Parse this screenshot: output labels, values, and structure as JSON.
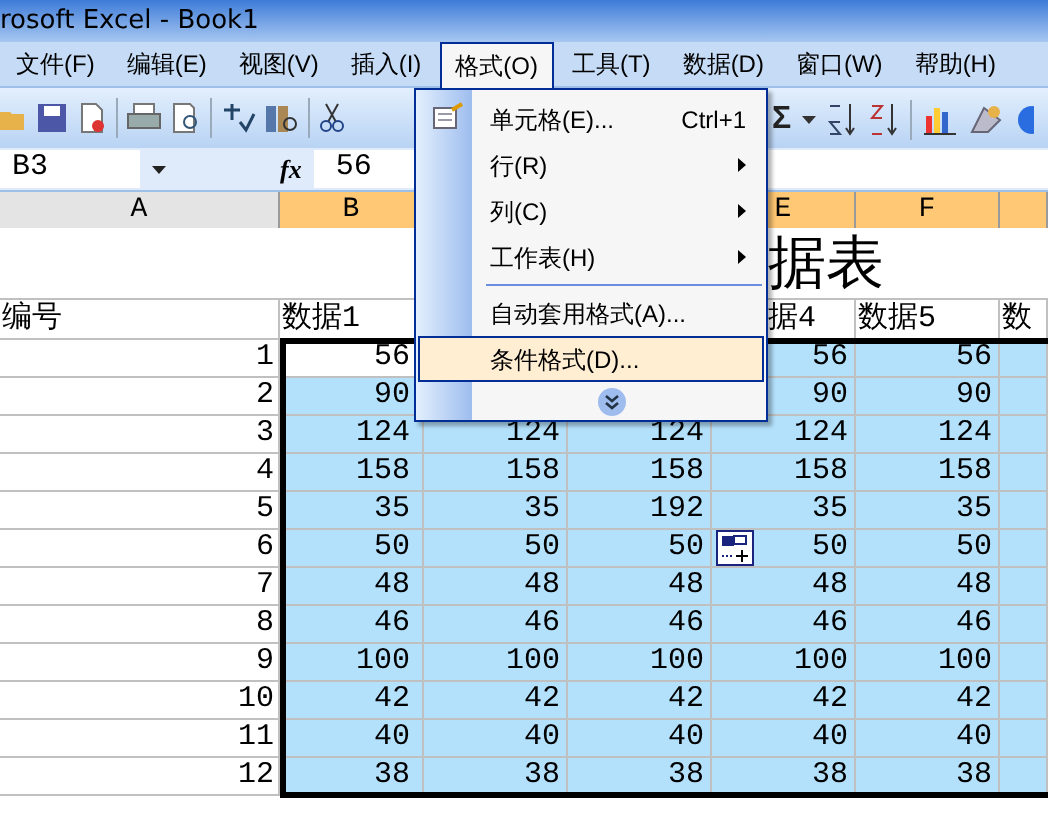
{
  "window": {
    "title": "rosoft Excel - Book1"
  },
  "menu_bar": [
    {
      "label": "文件(F)",
      "selected": false
    },
    {
      "label": "编辑(E)",
      "selected": false
    },
    {
      "label": "视图(V)",
      "selected": false
    },
    {
      "label": "插入(I)",
      "selected": false
    },
    {
      "label": "格式(O)",
      "selected": true
    },
    {
      "label": "工具(T)",
      "selected": false
    },
    {
      "label": "数据(D)",
      "selected": false
    },
    {
      "label": "窗口(W)",
      "selected": false
    },
    {
      "label": "帮助(H)",
      "selected": false
    }
  ],
  "toolbar": {
    "autosum": "Σ"
  },
  "formula_bar": {
    "name_box": "B3",
    "fx": "fx",
    "value": "56"
  },
  "sheet": {
    "columns": {
      "A": {
        "label": "A",
        "selected": false
      },
      "B": {
        "label": "B",
        "selected": true
      },
      "E": {
        "label": "E",
        "selected": true
      },
      "F": {
        "label": "F",
        "selected": true
      },
      "G": {
        "selected": true
      }
    },
    "title_fragment": "据表",
    "header_row": {
      "A": "编号",
      "B": "数据1",
      "E": "据4",
      "F": "数据5",
      "G": "数"
    },
    "rows": [
      {
        "number": "1",
        "cells": {
          "B": {
            "text": "56",
            "active": true
          },
          "E": {
            "text": "56",
            "selected": true,
            "active": false
          },
          "F": {
            "text": "56",
            "selected": true,
            "active": false
          },
          "G": {
            "selected": true,
            "active": false
          }
        }
      },
      {
        "number": "2",
        "cells": {
          "B": {
            "text": "90",
            "selected": true,
            "active": false
          },
          "E": {
            "text": "90",
            "selected": true,
            "active": false
          },
          "F": {
            "text": "90",
            "selected": true,
            "active": false
          },
          "G": {
            "selected": true,
            "active": false
          }
        }
      },
      {
        "number": "3",
        "cells": {
          "B": {
            "text": "124",
            "selected": true,
            "active": false
          },
          "C": {
            "text": "124",
            "selected": true,
            "active": false
          },
          "D": {
            "text": "124",
            "selected": true,
            "active": false
          },
          "E": {
            "text": "124",
            "selected": true,
            "active": false
          },
          "F": {
            "text": "124",
            "selected": true,
            "active": false
          },
          "G": {
            "selected": true,
            "active": false
          }
        }
      },
      {
        "number": "4",
        "cells": {
          "B": {
            "text": "158",
            "selected": true,
            "active": false
          },
          "C": {
            "text": "158",
            "selected": true,
            "active": false
          },
          "D": {
            "text": "158",
            "selected": true,
            "active": false
          },
          "E": {
            "text": "158",
            "selected": true,
            "active": false
          },
          "F": {
            "text": "158",
            "selected": true,
            "active": false
          },
          "G": {
            "selected": true,
            "active": false
          }
        }
      },
      {
        "number": "5",
        "cells": {
          "B": {
            "text": "35",
            "selected": true,
            "active": false
          },
          "C": {
            "text": "35",
            "selected": true,
            "active": false
          },
          "D": {
            "text": "192",
            "selected": true,
            "active": false
          },
          "E": {
            "text": "35",
            "selected": true,
            "active": false
          },
          "F": {
            "text": "35",
            "selected": true,
            "active": false
          },
          "G": {
            "selected": true,
            "active": false
          }
        }
      },
      {
        "number": "6",
        "cells": {
          "B": {
            "text": "50",
            "selected": true,
            "active": false
          },
          "C": {
            "text": "50",
            "selected": true,
            "active": false
          },
          "D": {
            "text": "50",
            "selected": true,
            "active": false
          },
          "E": {
            "text": "50",
            "selected": true,
            "active": false
          },
          "F": {
            "text": "50",
            "selected": true,
            "active": false
          },
          "G": {
            "selected": true,
            "active": false
          }
        }
      },
      {
        "number": "7",
        "cells": {
          "B": {
            "text": "48",
            "selected": true,
            "active": false
          },
          "C": {
            "text": "48",
            "selected": true,
            "active": false
          },
          "D": {
            "text": "48",
            "selected": true,
            "active": false
          },
          "E": {
            "text": "48",
            "selected": true,
            "active": false
          },
          "F": {
            "text": "48",
            "selected": true,
            "active": false
          },
          "G": {
            "selected": true,
            "active": false
          }
        }
      },
      {
        "number": "8",
        "cells": {
          "B": {
            "text": "46",
            "selected": true,
            "active": false
          },
          "C": {
            "text": "46",
            "selected": true,
            "active": false
          },
          "D": {
            "text": "46",
            "selected": true,
            "active": false
          },
          "E": {
            "text": "46",
            "selected": true,
            "active": false
          },
          "F": {
            "text": "46",
            "selected": true,
            "active": false
          },
          "G": {
            "selected": true,
            "active": false
          }
        }
      },
      {
        "number": "9",
        "cells": {
          "B": {
            "text": "100",
            "selected": true,
            "active": false
          },
          "C": {
            "text": "100",
            "selected": true,
            "active": false
          },
          "D": {
            "text": "100",
            "selected": true,
            "active": false
          },
          "E": {
            "text": "100",
            "selected": true,
            "active": false
          },
          "F": {
            "text": "100",
            "selected": true,
            "active": false
          },
          "G": {
            "selected": true,
            "active": false
          }
        }
      },
      {
        "number": "10",
        "cells": {
          "B": {
            "text": "42",
            "selected": true,
            "active": false
          },
          "C": {
            "text": "42",
            "selected": true,
            "active": false
          },
          "D": {
            "text": "42",
            "selected": true,
            "active": false
          },
          "E": {
            "text": "42",
            "selected": true,
            "active": false
          },
          "F": {
            "text": "42",
            "selected": true,
            "active": false
          },
          "G": {
            "selected": true,
            "active": false
          }
        }
      },
      {
        "number": "11",
        "cells": {
          "B": {
            "text": "40",
            "selected": true,
            "active": false
          },
          "C": {
            "text": "40",
            "selected": true,
            "active": false
          },
          "D": {
            "text": "40",
            "selected": true,
            "active": false
          },
          "E": {
            "text": "40",
            "selected": true,
            "active": false
          },
          "F": {
            "text": "40",
            "selected": true,
            "active": false
          },
          "G": {
            "selected": true,
            "active": false
          }
        }
      },
      {
        "number": "12",
        "cells": {
          "B": {
            "text": "38",
            "selected": true,
            "active": false
          },
          "C": {
            "text": "38",
            "selected": true,
            "active": false
          },
          "D": {
            "text": "38",
            "selected": true,
            "active": false
          },
          "E": {
            "text": "38",
            "selected": true,
            "active": false
          },
          "F": {
            "text": "38",
            "selected": true,
            "active": false
          },
          "G": {
            "selected": true,
            "active": false
          }
        }
      }
    ]
  },
  "format_menu": {
    "items": [
      {
        "kind": "item",
        "label": "单元格(E)...",
        "shortcut": "Ctrl+1",
        "submenu": false,
        "selected": false
      },
      {
        "kind": "item",
        "label": "行(R)",
        "submenu": true,
        "selected": false
      },
      {
        "kind": "item",
        "label": "列(C)",
        "submenu": true,
        "selected": false
      },
      {
        "kind": "item",
        "label": "工作表(H)",
        "submenu": true,
        "selected": false
      },
      {
        "kind": "separator"
      },
      {
        "kind": "item",
        "label": "自动套用格式(A)...",
        "submenu": false,
        "selected": false
      },
      {
        "kind": "item",
        "label": "条件格式(D)...",
        "submenu": false,
        "selected": true
      },
      {
        "kind": "expand"
      }
    ]
  }
}
